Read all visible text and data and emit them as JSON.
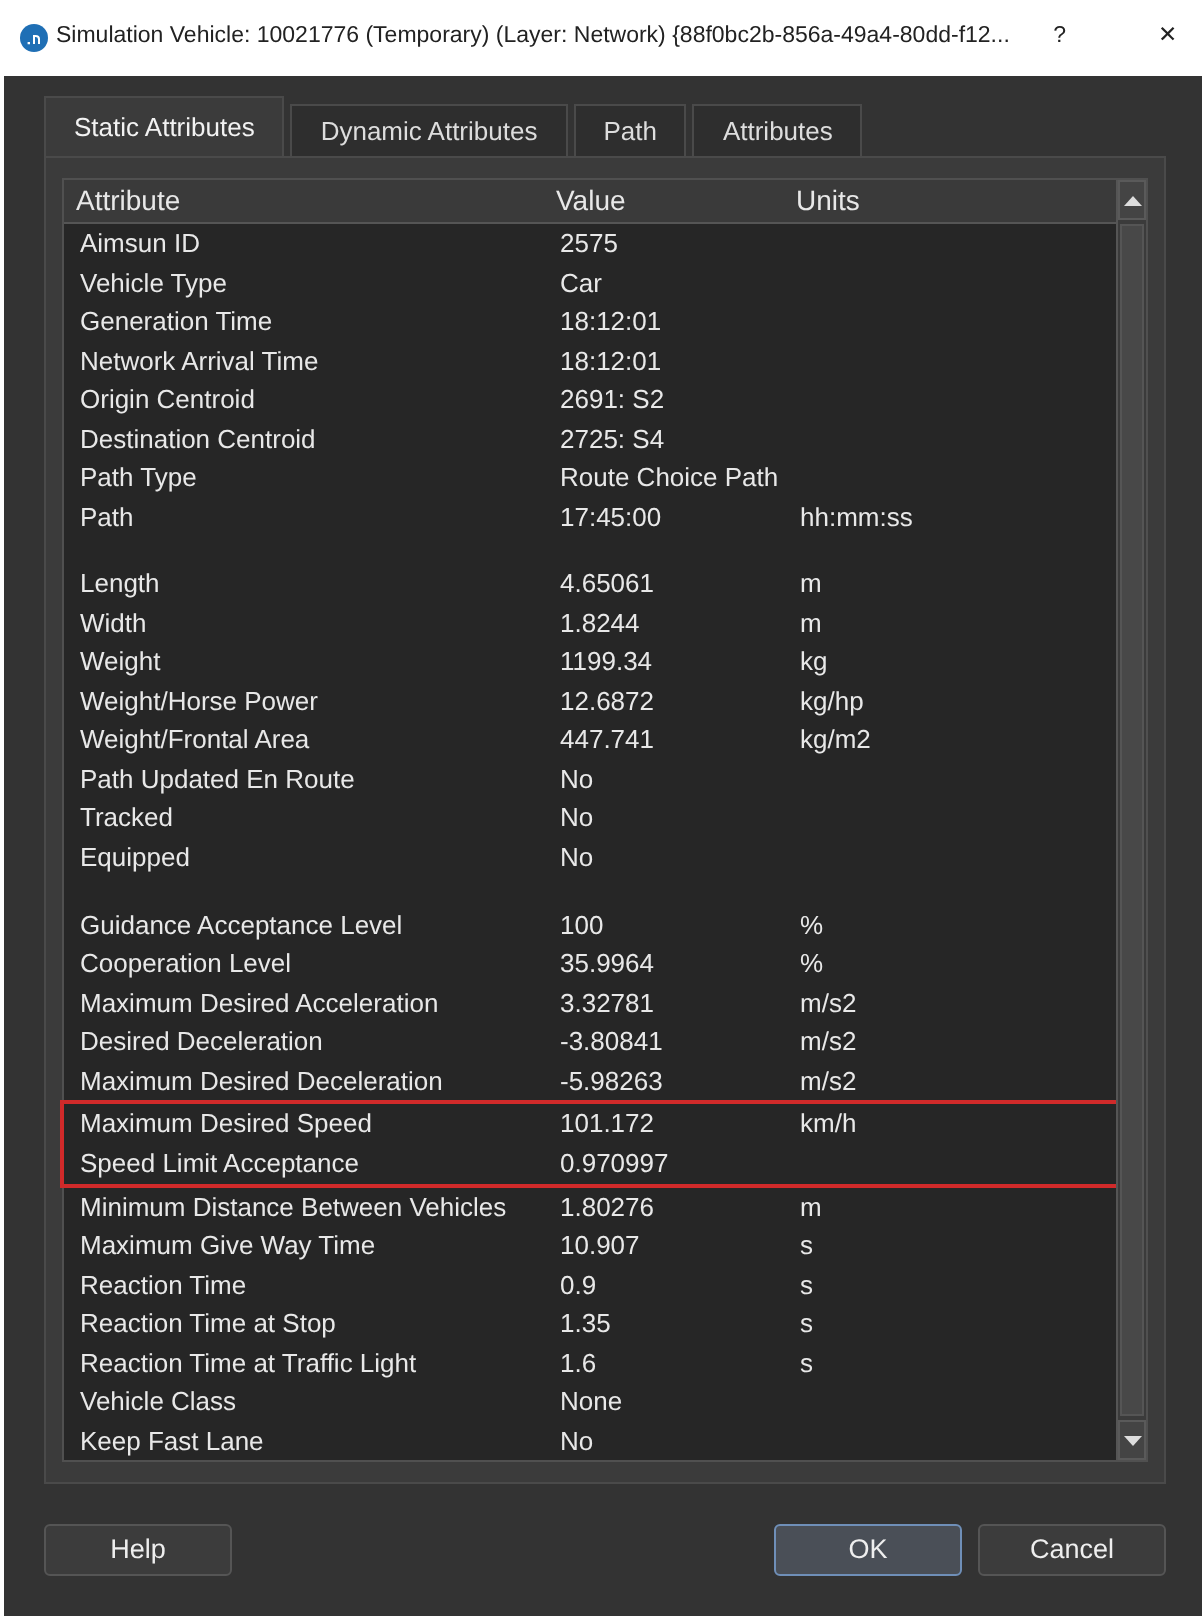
{
  "window": {
    "title": "Simulation Vehicle: 10021776 (Temporary) (Layer: Network) {88f0bc2b-856a-49a4-80dd-f12...",
    "help_glyph": "?",
    "close_glyph": "✕"
  },
  "tabs": [
    {
      "label": "Static Attributes",
      "selected": true
    },
    {
      "label": "Dynamic Attributes",
      "selected": false
    },
    {
      "label": "Path",
      "selected": false
    },
    {
      "label": "Attributes",
      "selected": false
    }
  ],
  "table": {
    "columns": [
      "Attribute",
      "Value",
      "Units"
    ],
    "rows": [
      {
        "kind": "data",
        "attribute": "Aimsun ID",
        "value": "2575",
        "highlighted": false
      },
      {
        "kind": "data",
        "attribute": "Vehicle Type",
        "value": "Car",
        "highlighted": false
      },
      {
        "kind": "data",
        "attribute": "Generation Time",
        "value": "18:12:01",
        "highlighted": false
      },
      {
        "kind": "data",
        "attribute": "Network Arrival Time",
        "value": "18:12:01",
        "highlighted": false
      },
      {
        "kind": "data",
        "attribute": "Origin Centroid",
        "value": "2691: S2",
        "highlighted": false
      },
      {
        "kind": "data",
        "attribute": "Destination Centroid",
        "value": "2725: S4",
        "highlighted": false
      },
      {
        "kind": "data",
        "attribute": "Path Type",
        "value": "Route Choice Path",
        "highlighted": false
      },
      {
        "kind": "data",
        "attribute": "Path",
        "value": "17:45:00",
        "units": "hh:mm:ss",
        "highlighted": false
      },
      {
        "kind": "blank"
      },
      {
        "kind": "data",
        "attribute": "Length",
        "value": "4.65061",
        "units": "m",
        "highlighted": false
      },
      {
        "kind": "data",
        "attribute": "Width",
        "value": "1.8244",
        "units": "m",
        "highlighted": false
      },
      {
        "kind": "data",
        "attribute": "Weight",
        "value": "1199.34",
        "units": "kg",
        "highlighted": false
      },
      {
        "kind": "data",
        "attribute": "Weight/Horse Power",
        "value": "12.6872",
        "units": "kg/hp",
        "highlighted": false
      },
      {
        "kind": "data",
        "attribute": "Weight/Frontal Area",
        "value": "447.741",
        "units": "kg/m2",
        "highlighted": false
      },
      {
        "kind": "data",
        "attribute": "Path Updated En Route",
        "value": "No",
        "highlighted": false
      },
      {
        "kind": "data",
        "attribute": "Tracked",
        "value": "No",
        "highlighted": false
      },
      {
        "kind": "data",
        "attribute": "Equipped",
        "value": "No",
        "highlighted": false
      },
      {
        "kind": "blank"
      },
      {
        "kind": "data",
        "attribute": "Guidance Acceptance Level",
        "value": "100",
        "units": "%",
        "highlighted": false
      },
      {
        "kind": "data",
        "attribute": "Cooperation Level",
        "value": "35.9964",
        "units": "%",
        "highlighted": false
      },
      {
        "kind": "data",
        "attribute": "Maximum Desired Acceleration",
        "value": "3.32781",
        "units": "m/s2",
        "highlighted": false
      },
      {
        "kind": "data",
        "attribute": "Desired Deceleration",
        "value": "-3.80841",
        "units": "m/s2",
        "highlighted": false
      },
      {
        "kind": "data",
        "attribute": "Maximum Desired Deceleration",
        "value": "-5.98263",
        "units": "m/s2",
        "highlighted": false
      },
      {
        "kind": "data",
        "attribute": "Maximum Desired Speed",
        "value": "101.172",
        "units": "km/h",
        "highlighted": true
      },
      {
        "kind": "data",
        "attribute": "Speed Limit Acceptance",
        "value": "0.970997",
        "highlighted": true
      },
      {
        "kind": "data",
        "attribute": "Minimum Distance Between Vehicles",
        "value": "1.80276",
        "units": "m",
        "highlighted": false
      },
      {
        "kind": "data",
        "attribute": "Maximum Give Way Time",
        "value": "10.907",
        "units": "s",
        "highlighted": false
      },
      {
        "kind": "data",
        "attribute": "Reaction Time",
        "value": "0.9",
        "units": "s",
        "highlighted": false
      },
      {
        "kind": "data",
        "attribute": "Reaction Time at Stop",
        "value": "1.35",
        "units": "s",
        "highlighted": false
      },
      {
        "kind": "data",
        "attribute": "Reaction Time at Traffic Light",
        "value": "1.6",
        "units": "s",
        "highlighted": false
      },
      {
        "kind": "data",
        "attribute": "Vehicle Class",
        "value": "None",
        "highlighted": false
      },
      {
        "kind": "data",
        "attribute": "Keep Fast Lane",
        "value": "No",
        "highlighted": false
      }
    ]
  },
  "buttons": [
    {
      "label": "Help",
      "default": false
    },
    {
      "label": "OK",
      "default": true
    },
    {
      "label": "Cancel",
      "default": false
    }
  ]
}
